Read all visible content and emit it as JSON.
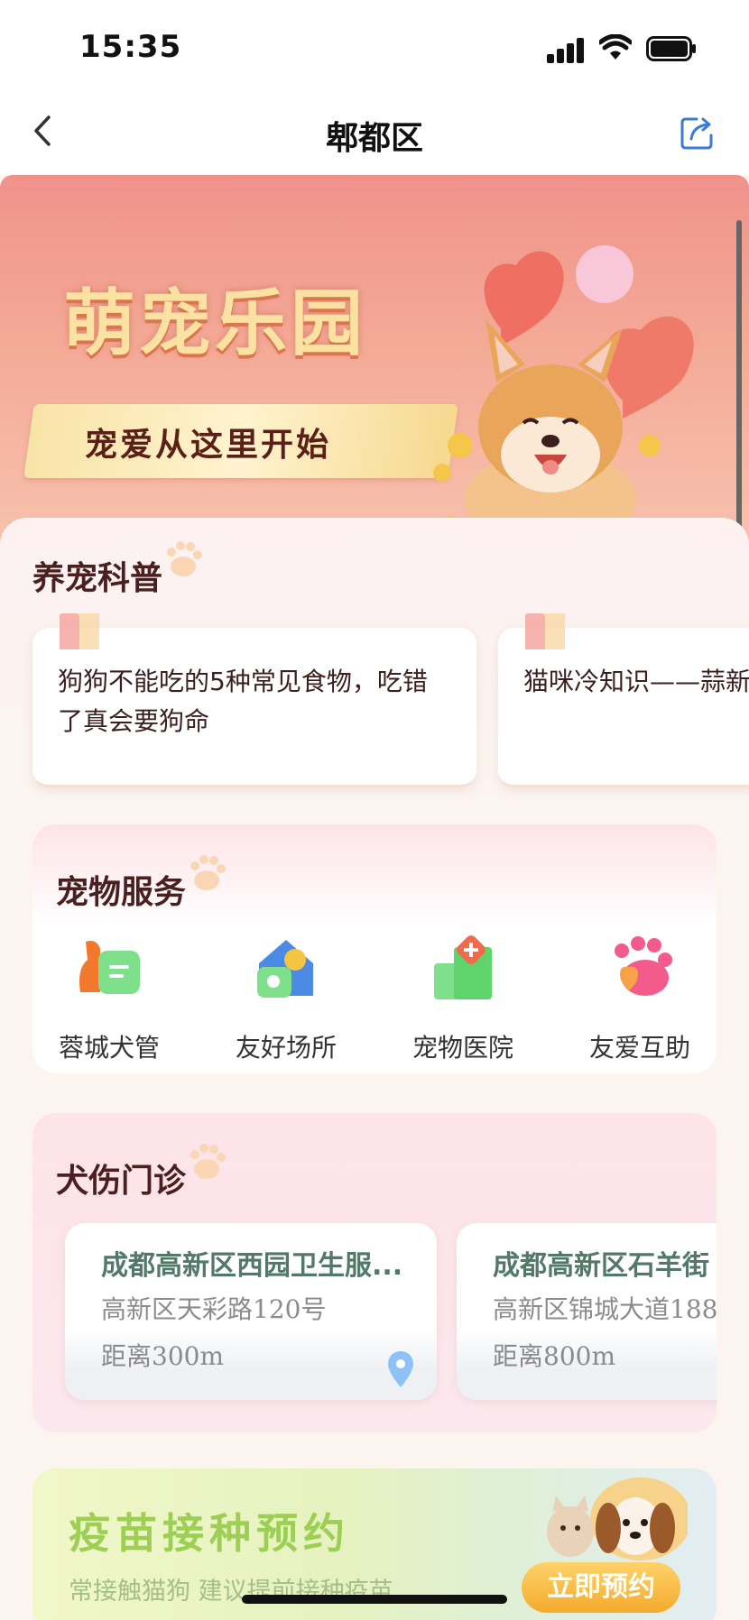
{
  "status": {
    "time": "15:35"
  },
  "nav": {
    "title": "郫都区"
  },
  "hero": {
    "title": "萌宠乐园",
    "subtitle": "宠爱从这里开始"
  },
  "science": {
    "title": "养宠科普",
    "articles": [
      {
        "text": "狗狗不能吃的5种常见食物，吃错了真会要狗命"
      },
      {
        "text": "猫咪冷知识——蒜新"
      }
    ]
  },
  "services": {
    "title": "宠物服务",
    "items": [
      {
        "label": "蓉城犬管",
        "icon": "dog-id-icon"
      },
      {
        "label": "友好场所",
        "icon": "pet-friendly-place-icon"
      },
      {
        "label": "宠物医院",
        "icon": "pet-hospital-icon"
      },
      {
        "label": "友爱互助",
        "icon": "paw-heart-icon"
      }
    ]
  },
  "clinics": {
    "title": "犬伤门诊",
    "items": [
      {
        "name": "成都高新区西园卫生服...",
        "address": "高新区天彩路120号",
        "distance": "距离300m"
      },
      {
        "name": "成都高新区石羊街",
        "address": "高新区锦城大道188",
        "distance": "距离800m"
      }
    ]
  },
  "vaccine": {
    "title": "疫苗接种预约",
    "subtitle": "常接触猫狗 建议提前接种疫苗",
    "button": "立即预约"
  },
  "colors": {
    "accent_green": "#52786a",
    "hero_pink": "#f0928a",
    "vaccine_green": "#9ccf53",
    "button_orange": "#f3ab2c"
  }
}
